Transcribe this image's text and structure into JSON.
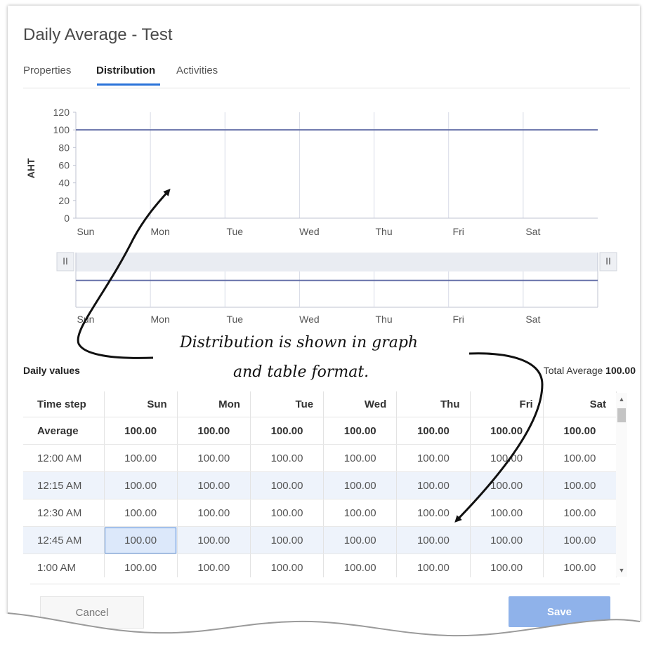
{
  "dialog": {
    "title": "Daily Average - Test",
    "tabs": [
      {
        "label": "Properties",
        "active": false
      },
      {
        "label": "Distribution",
        "active": true
      },
      {
        "label": "Activities",
        "active": false
      }
    ]
  },
  "chart_data": {
    "type": "line",
    "ylabel": "AHT",
    "ylim": [
      0,
      120
    ],
    "yticks": [
      0,
      20,
      40,
      60,
      80,
      100,
      120
    ],
    "x_labels": [
      "Sun",
      "Mon",
      "Tue",
      "Wed",
      "Thu",
      "Fri",
      "Sat"
    ],
    "series": [
      {
        "values": [
          100,
          100,
          100,
          100,
          100,
          100,
          100
        ]
      }
    ],
    "grid": true,
    "navigator": {
      "handle_left": "II",
      "handle_right": "II"
    }
  },
  "table": {
    "label": "Daily values",
    "total_prefix": "Total Average",
    "total_value": "100.00",
    "headers": [
      "Time step",
      "Sun",
      "Mon",
      "Tue",
      "Wed",
      "Thu",
      "Fri",
      "Sat"
    ],
    "rows": [
      {
        "label": "Average",
        "values": [
          "100.00",
          "100.00",
          "100.00",
          "100.00",
          "100.00",
          "100.00",
          "100.00"
        ]
      },
      {
        "label": "12:00 AM",
        "values": [
          "100.00",
          "100.00",
          "100.00",
          "100.00",
          "100.00",
          "100.00",
          "100.00"
        ]
      },
      {
        "label": "12:15 AM",
        "values": [
          "100.00",
          "100.00",
          "100.00",
          "100.00",
          "100.00",
          "100.00",
          "100.00"
        ]
      },
      {
        "label": "12:30 AM",
        "values": [
          "100.00",
          "100.00",
          "100.00",
          "100.00",
          "100.00",
          "100.00",
          "100.00"
        ]
      },
      {
        "label": "12:45 AM",
        "values": [
          "100.00",
          "100.00",
          "100.00",
          "100.00",
          "100.00",
          "100.00",
          "100.00"
        ]
      },
      {
        "label": "1:00 AM",
        "values": [
          "100.00",
          "100.00",
          "100.00",
          "100.00",
          "100.00",
          "100.00",
          "100.00"
        ]
      },
      {
        "label": "",
        "values": [
          "",
          "",
          "",
          "",
          "",
          "",
          ""
        ]
      }
    ]
  },
  "buttons": {
    "cancel": "Cancel",
    "save": "Save"
  },
  "annotation": {
    "line1": "Distribution is shown in graph",
    "line2": "and table format."
  },
  "colors": {
    "accent": "#2a73d9",
    "series": "#6570a8",
    "grid": "#d8dbe6",
    "save_button": "#8fb2ea",
    "selected_cell": "#dce8fa"
  }
}
